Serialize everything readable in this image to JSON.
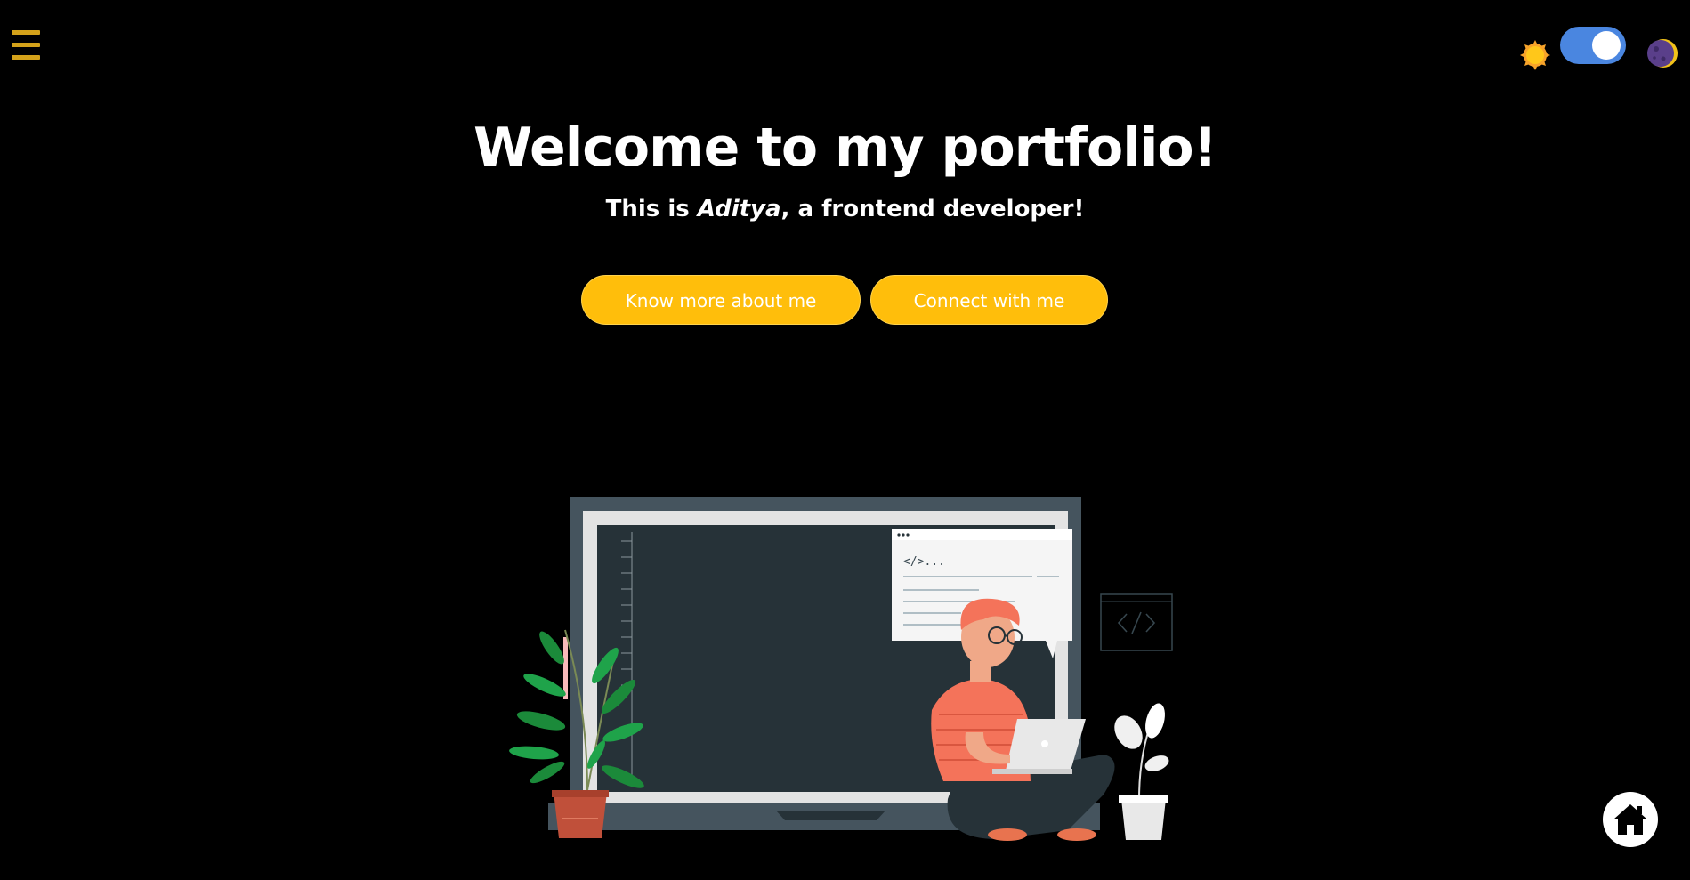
{
  "nav": {
    "menu_icon": "hamburger-menu-icon"
  },
  "theme": {
    "light_icon": "sun-icon",
    "dark_icon": "moon-icon",
    "mode": "dark",
    "toggle_color": "#4a86e0"
  },
  "hero": {
    "title": "Welcome to my portfolio!",
    "subtitle_prefix": "This is ",
    "subtitle_name": "Aditya",
    "subtitle_suffix": ", a frontend developer!"
  },
  "buttons": {
    "about_label": "Know more about me",
    "connect_label": "Connect with me",
    "color": "#ffbe0b"
  },
  "illustration": {
    "code_snippet": "</>...",
    "code_icon": "code-brackets-icon"
  },
  "home": {
    "icon": "home-icon"
  }
}
